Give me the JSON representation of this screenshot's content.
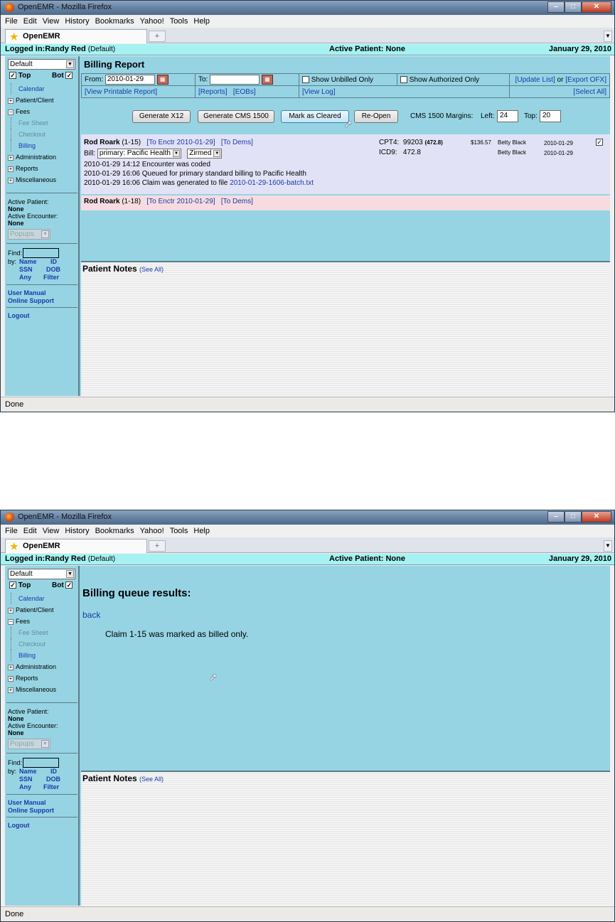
{
  "browser": {
    "title": "OpenEMR - Mozilla Firefox",
    "menu": [
      "File",
      "Edit",
      "View",
      "History",
      "Bookmarks",
      "Yahoo!",
      "Tools",
      "Help"
    ],
    "tab_label": "OpenEMR",
    "new_tab": "+",
    "status": "Done"
  },
  "header": {
    "logged_in": "Logged in:Randy Red",
    "logged_in_suffix": "(Default)",
    "active_patient": "Active Patient: None",
    "date": "January 29, 2010"
  },
  "sidebar": {
    "view_select": "Default",
    "top_label": "Top",
    "bot_label": "Bot",
    "items": {
      "calendar": "Calendar",
      "patient_client": "Patient/Client",
      "fees": "Fees",
      "fee_sheet": "Fee Sheet",
      "checkout": "Checkout",
      "billing": "Billing",
      "administration": "Administration",
      "reports": "Reports",
      "miscellaneous": "Miscellaneous"
    },
    "active_patient_label": "Active Patient:",
    "active_patient_value": "None",
    "active_encounter_label": "Active Encounter:",
    "active_encounter_value": "None",
    "popups": "Popups",
    "find_label": "Find:",
    "by_label": "by:",
    "find_name": "Name",
    "find_id": "ID",
    "find_ssn": "SSN",
    "find_dob": "DOB",
    "find_any": "Any",
    "find_filter": "Filter",
    "user_manual": "User Manual",
    "online_support": "Online Support",
    "logout": "Logout"
  },
  "billing": {
    "title": "Billing Report",
    "from_label": "From:",
    "from_value": "2010-01-29",
    "to_label": "To:",
    "show_unbilled": "Show Unbilled Only",
    "show_authorized": "Show Authorized Only",
    "update_list": "[Update List]",
    "or": "or",
    "export_ofx": "[Export OFX]",
    "view_printable": "[View Printable Report]",
    "reports_link": "[Reports]",
    "eobs_link": "[EOBs]",
    "view_log": "[View Log]",
    "select_all": "[Select All]",
    "buttons": {
      "generate_x12": "Generate X12",
      "generate_cms": "Generate CMS 1500",
      "mark_cleared": "Mark as Cleared",
      "reopen": "Re-Open"
    },
    "margins_label": "CMS 1500 Margins:",
    "left_label": "Left:",
    "left_value": "24",
    "top_label": "Top:",
    "top_value": "20",
    "record1": {
      "name": "Rod Roark",
      "pid": "(1-15)",
      "encounter_link": "[To Enctr 2010-01-29]",
      "dems_link": "[To Dems]",
      "bill_label": "Bill:",
      "bill_value": "primary: Pacific Health",
      "partner_value": "Zirmed",
      "log1": "2010-01-29 14:12 Encounter was coded",
      "log2": "2010-01-29 16:06 Queued for primary standard billing to Pacific Health",
      "log3_prefix": "2010-01-29 16:06 Claim was generated to file",
      "log3_file": "2010-01-29-1606-batch.txt",
      "cpt_label": "CPT4:",
      "cpt_value": "99203",
      "cpt_mod": "(472.8)",
      "icd_label": "ICD9:",
      "icd_value": "472.8",
      "fee": "$136.57",
      "provider1": "Betty Black",
      "provider2": "Betty Black",
      "date1": "2010-01-29",
      "date2": "2010-01-29"
    },
    "record2": {
      "name": "Rod Roark",
      "pid": "(1-18)",
      "encounter_link": "[To Enctr 2010-01-29]",
      "dems_link": "[To Dems]"
    }
  },
  "notes": {
    "title": "Patient Notes",
    "see_all": "(See All)"
  },
  "results": {
    "title": "Billing queue results:",
    "back": "back",
    "message": "Claim 1-15 was marked as billed only."
  },
  "colors": {
    "sidebar_bg": "#96d4e4",
    "header_bg": "#a6f2f2",
    "record1_bg": "#e2e2f6",
    "record2_bg": "#f6dce0",
    "link": "#1a3aa8"
  }
}
